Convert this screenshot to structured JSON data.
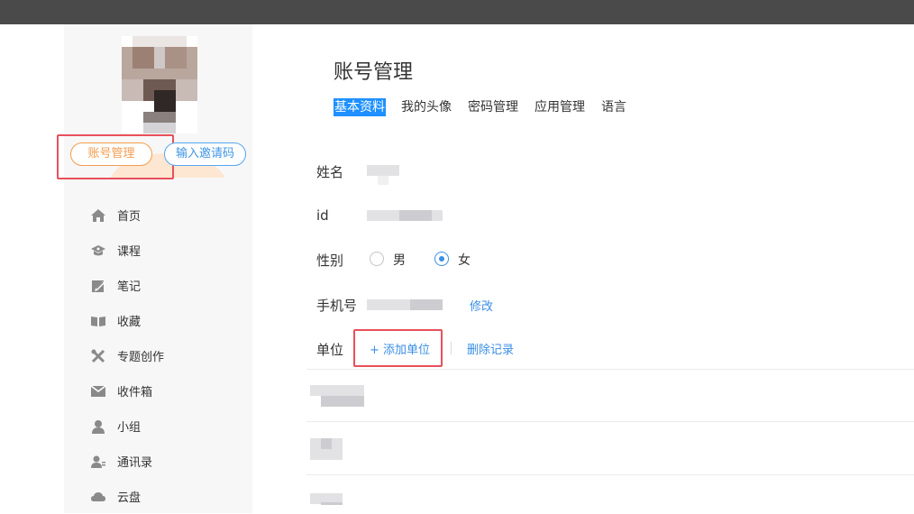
{
  "sidebar": {
    "account_button": "账号管理",
    "invite_button": "输入邀请码",
    "nav": [
      {
        "label": "首页",
        "icon": "home-icon"
      },
      {
        "label": "课程",
        "icon": "graduation-cap-icon"
      },
      {
        "label": "笔记",
        "icon": "notebook-edit-icon"
      },
      {
        "label": "收藏",
        "icon": "open-book-icon"
      },
      {
        "label": "专题创作",
        "icon": "tools-icon"
      },
      {
        "label": "收件箱",
        "icon": "inbox-mail-icon"
      },
      {
        "label": "小组",
        "icon": "user-icon"
      },
      {
        "label": "通讯录",
        "icon": "contacts-icon"
      },
      {
        "label": "云盘",
        "icon": "cloud-icon"
      }
    ]
  },
  "main": {
    "title": "账号管理",
    "tabs": [
      {
        "label": "基本资料",
        "active": true
      },
      {
        "label": "我的头像",
        "active": false
      },
      {
        "label": "密码管理",
        "active": false
      },
      {
        "label": "应用管理",
        "active": false
      },
      {
        "label": "语言",
        "active": false
      }
    ],
    "fields": {
      "name_label": "姓名",
      "id_label": "id",
      "gender_label": "性别",
      "gender_options": [
        "男",
        "女"
      ],
      "gender_selected": "女",
      "phone_label": "手机号",
      "phone_edit": "修改",
      "unit_label": "单位",
      "add_unit": "+ 添加单位",
      "delete_record": "删除记录"
    }
  },
  "colors": {
    "topbar": "#4a4a4a",
    "accent_blue": "#3a8ee6",
    "tab_active_bg": "#1e90ff",
    "orange": "#f29d4f",
    "highlight_red": "#e8505b"
  }
}
